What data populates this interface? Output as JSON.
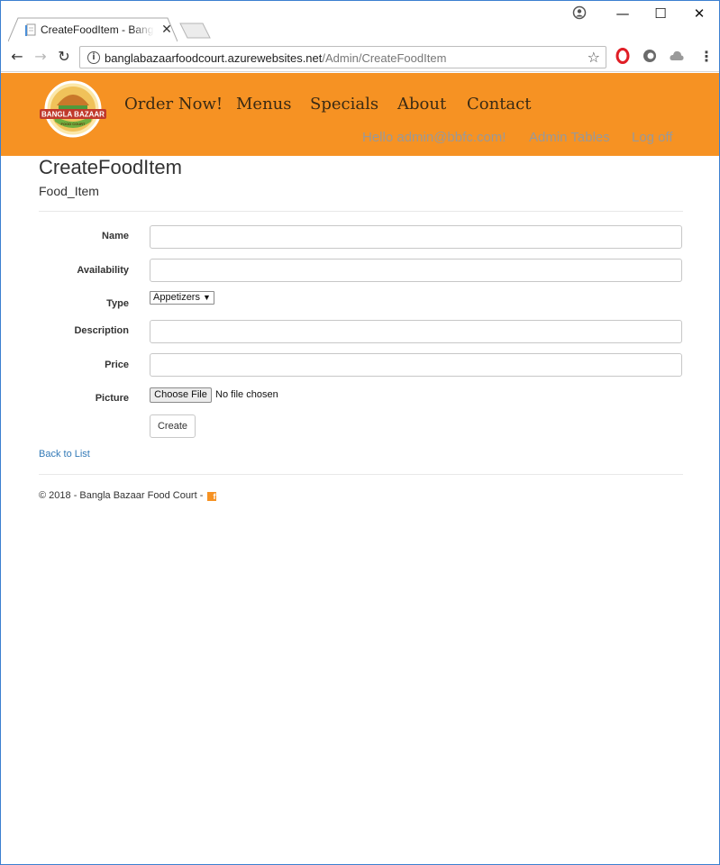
{
  "browser": {
    "tab_title": "CreateFoodItem - Bangla Bazaar Food Court",
    "tab_close": "✕",
    "url_host": "banglabazaarfoodcourt.azurewebsites.net",
    "url_path": "/Admin/CreateFoodItem",
    "window_controls": {
      "minimize": "—",
      "maximize": "☐",
      "close": "✕"
    }
  },
  "header": {
    "logo_text": "BANGLA BAZAAR",
    "logo_subtext": "FOOD COURT",
    "brand_color": "#f69223",
    "nav": [
      "Order Now!",
      "Menus",
      "Specials",
      "About",
      "Contact"
    ],
    "user_links": [
      "Hello admin@bbfc.com!",
      "Admin Tables",
      "Log off"
    ]
  },
  "page": {
    "title": "CreateFoodItem",
    "subtitle": "Food_Item"
  },
  "form": {
    "name_label": "Name",
    "availability_label": "Availability",
    "type_label": "Type",
    "type_selected": "Appetizers",
    "description_label": "Description",
    "price_label": "Price",
    "picture_label": "Picture",
    "choose_file_label": "Choose File",
    "file_status": "No file chosen",
    "submit_label": "Create"
  },
  "back_link": "Back to List",
  "footer": {
    "text": "© 2018 - Bangla Bazaar Food Court -",
    "social_icon": "f"
  }
}
